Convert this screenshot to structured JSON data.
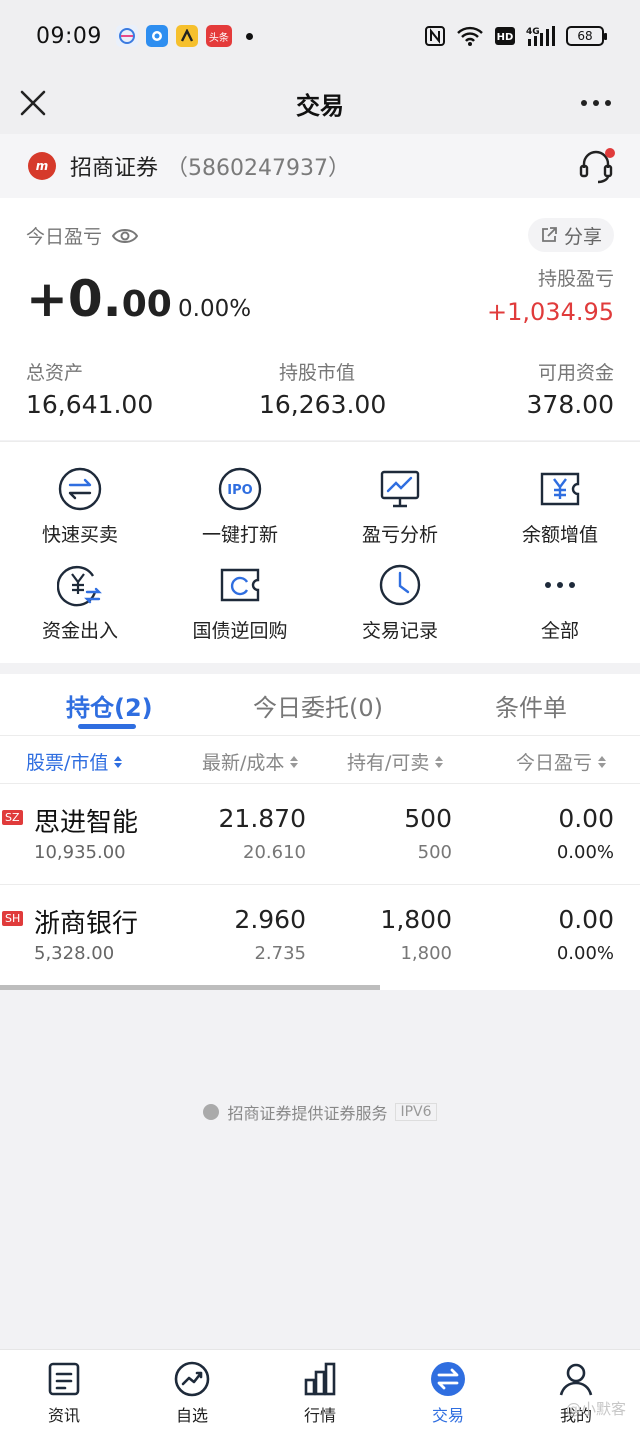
{
  "status_bar": {
    "time": "09:09",
    "battery": "68",
    "app_badge_news": "头条"
  },
  "title_bar": {
    "title": "交易"
  },
  "broker": {
    "name": "招商证券",
    "account": "（5860247937）",
    "logo_text": "m"
  },
  "summary": {
    "today_pnl_label": "今日盈亏",
    "share_label": "分享",
    "today_pnl_int": "+0.",
    "today_pnl_dec": "00",
    "today_pnl_pct": "0.00%",
    "holding_pnl_label": "持股盈亏",
    "holding_pnl_value": "+1,034.95",
    "total_assets_label": "总资产",
    "total_assets_value": "16,641.00",
    "market_value_label": "持股市值",
    "market_value_value": "16,263.00",
    "available_cash_label": "可用资金",
    "available_cash_value": "378.00"
  },
  "quick_actions": [
    {
      "label": "快速买卖",
      "icon": "swap-icon"
    },
    {
      "label": "一键打新",
      "icon": "ipo-icon"
    },
    {
      "label": "盈亏分析",
      "icon": "chart-monitor-icon"
    },
    {
      "label": "余额增值",
      "icon": "yen-ticket-icon"
    },
    {
      "label": "资金出入",
      "icon": "yen-transfer-icon"
    },
    {
      "label": "国债逆回购",
      "icon": "bond-ticket-icon"
    },
    {
      "label": "交易记录",
      "icon": "clock-icon"
    },
    {
      "label": "全部",
      "icon": "more-dots-icon"
    }
  ],
  "holdings": {
    "tabs": [
      "持仓(2)",
      "今日委托(0)",
      "条件单"
    ],
    "columns": [
      "股票/市值",
      "最新/成本",
      "持有/可卖",
      "今日盈亏"
    ],
    "rows": [
      {
        "market": "SZ",
        "name": "思进智能",
        "market_value": "10,935.00",
        "latest": "21.870",
        "cost": "20.610",
        "held": "500",
        "sellable": "500",
        "pnl": "0.00",
        "pnl_pct": "0.00%"
      },
      {
        "market": "SH",
        "name": "浙商银行",
        "market_value": "5,328.00",
        "latest": "2.960",
        "cost": "2.735",
        "held": "1,800",
        "sellable": "1,800",
        "pnl": "0.00",
        "pnl_pct": "0.00%"
      }
    ]
  },
  "footer_note": {
    "text": "招商证券提供证券服务",
    "ipv": "IPV6"
  },
  "bottom_nav": [
    {
      "label": "资讯",
      "icon": "news-icon"
    },
    {
      "label": "自选",
      "icon": "trend-icon"
    },
    {
      "label": "行情",
      "icon": "bar-chart-icon"
    },
    {
      "label": "交易",
      "icon": "trade-swap-icon"
    },
    {
      "label": "我的",
      "icon": "person-icon"
    }
  ],
  "watermark": "@小默客",
  "colors": {
    "accent": "#2f6ee0",
    "up": "#e03b3b",
    "dark": "#1e2a3a"
  }
}
